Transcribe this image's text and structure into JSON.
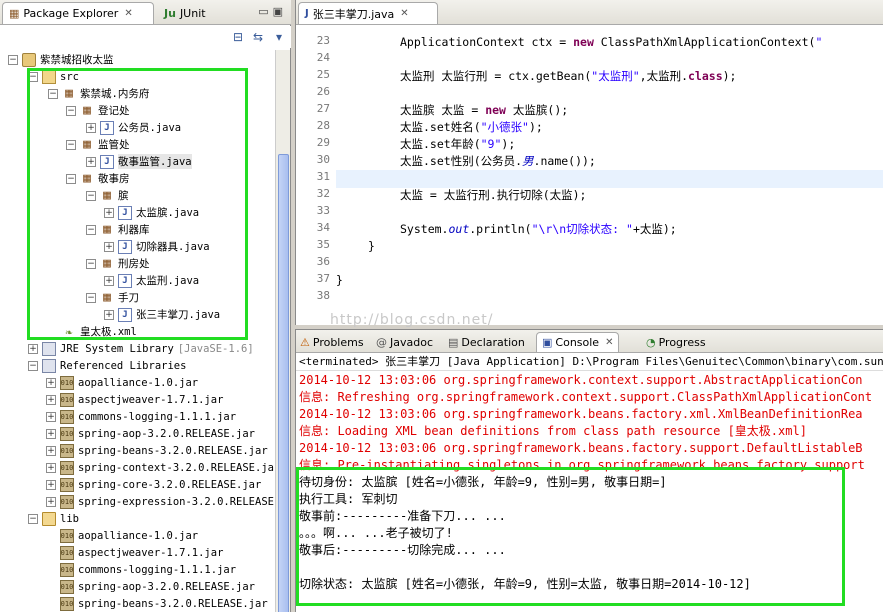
{
  "left_panel": {
    "tab_package_explorer": "Package Explorer",
    "tab_junit": "JUnit",
    "tree": [
      {
        "label": "紫禁城招收太监",
        "kind": "proj"
      },
      {
        "label": "src",
        "kind": "src"
      },
      {
        "label": "紫禁城.内务府",
        "kind": "pkg"
      },
      {
        "label": "登记处",
        "kind": "pkg"
      },
      {
        "label": "公务员.java",
        "kind": "java"
      },
      {
        "label": "监管处",
        "kind": "pkg"
      },
      {
        "label": "敬事监管.java",
        "kind": "java"
      },
      {
        "label": "敬事房",
        "kind": "pkg"
      },
      {
        "label": "膑",
        "kind": "pkg"
      },
      {
        "label": "太监膑.java",
        "kind": "java"
      },
      {
        "label": "利器库",
        "kind": "pkg"
      },
      {
        "label": "切除器具.java",
        "kind": "java"
      },
      {
        "label": "刑房处",
        "kind": "pkg"
      },
      {
        "label": "太监刑.java",
        "kind": "java"
      },
      {
        "label": "手刀",
        "kind": "pkg"
      },
      {
        "label": "张三丰掌刀.java",
        "kind": "java"
      },
      {
        "label": "皇太极.xml",
        "kind": "xml"
      },
      {
        "label": "JRE System Library",
        "suffix": "[JavaSE-1.6]",
        "kind": "lib"
      },
      {
        "label": "Referenced Libraries",
        "kind": "lib"
      },
      {
        "label": "aopalliance-1.0.jar",
        "kind": "jar"
      },
      {
        "label": "aspectjweaver-1.7.1.jar",
        "kind": "jar"
      },
      {
        "label": "commons-logging-1.1.1.jar",
        "kind": "jar"
      },
      {
        "label": "spring-aop-3.2.0.RELEASE.jar",
        "kind": "jar"
      },
      {
        "label": "spring-beans-3.2.0.RELEASE.jar",
        "kind": "jar"
      },
      {
        "label": "spring-context-3.2.0.RELEASE.jar",
        "kind": "jar"
      },
      {
        "label": "spring-core-3.2.0.RELEASE.jar",
        "kind": "jar"
      },
      {
        "label": "spring-expression-3.2.0.RELEASE.",
        "kind": "jar"
      },
      {
        "label": "lib",
        "kind": "folder"
      },
      {
        "label": "aopalliance-1.0.jar",
        "kind": "jar"
      },
      {
        "label": "aspectjweaver-1.7.1.jar",
        "kind": "jar"
      },
      {
        "label": "commons-logging-1.1.1.jar",
        "kind": "jar"
      },
      {
        "label": "spring-aop-3.2.0.RELEASE.jar",
        "kind": "jar"
      },
      {
        "label": "spring-beans-3.2.0.RELEASE.jar",
        "kind": "jar"
      }
    ]
  },
  "editor": {
    "tab_title": "张三丰掌刀.java",
    "line_numbers": [
      "23",
      "24",
      "25",
      "26",
      "27",
      "28",
      "29",
      "30",
      "31",
      "32",
      "33",
      "34",
      "35",
      "36",
      "37",
      "38"
    ]
  },
  "console": {
    "tabs": {
      "problems": "Problems",
      "javadoc": "Javadoc",
      "declaration": "Declaration",
      "console": "Console",
      "progress": "Progress"
    },
    "header": "<terminated> 张三丰掌刀 [Java Application] D:\\Program Files\\Genuitec\\Common\\binary\\com.sun.java.jdk",
    "lines": [
      {
        "text": "2014-10-12 13:03:06 org.springframework.context.support.AbstractApplicationCon",
        "color": "red"
      },
      {
        "text": "信息: Refreshing org.springframework.context.support.ClassPathXmlApplicationCont",
        "color": "red"
      },
      {
        "text": "2014-10-12 13:03:06 org.springframework.beans.factory.xml.XmlBeanDefinitionRea",
        "color": "red"
      },
      {
        "text": "信息: Loading XML bean definitions from class path resource [皇太极.xml]",
        "color": "red"
      },
      {
        "text": "2014-10-12 13:03:06 org.springframework.beans.factory.support.DefaultListableB",
        "color": "red"
      },
      {
        "text": "信息: Pre-instantiating singletons in org.springframework.beans.factory.support",
        "color": "red"
      },
      {
        "text": "待切身份: 太监膑 [姓名=小德张, 年龄=9, 性别=男, 敬事日期=]",
        "color": "black"
      },
      {
        "text": "执行工具: 军刺切",
        "color": "black"
      },
      {
        "text": "敬事前:---------准备下刀... ...",
        "color": "black"
      },
      {
        "text": "。。。啊... ...老子被切了!",
        "color": "black"
      },
      {
        "text": "敬事后:---------切除完成... ...",
        "color": "black"
      },
      {
        "text": "",
        "color": "black"
      },
      {
        "text": "切除状态: 太监膑 [姓名=小德张, 年龄=9, 性别=太监, 敬事日期=2014-10-12]",
        "color": "black"
      }
    ]
  },
  "watermark": "http://blog.csdn.net/"
}
